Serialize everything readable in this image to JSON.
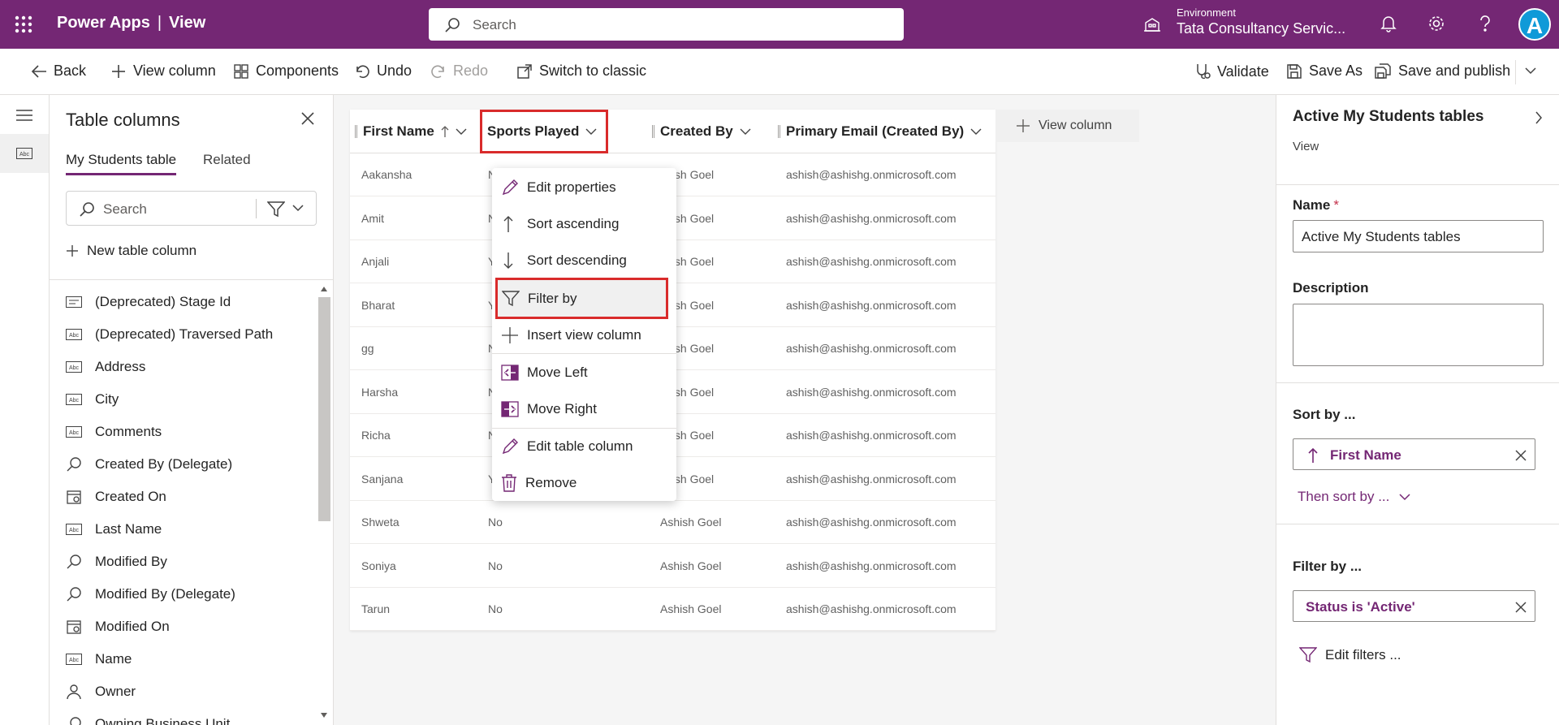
{
  "appbar": {
    "app_name": "Power Apps",
    "separator": "|",
    "section": "View",
    "search_placeholder": "Search",
    "environment_label": "Environment",
    "environment_value": "Tata Consultancy Servic...",
    "avatar_letter": "A"
  },
  "cmdbar": {
    "back": "Back",
    "view_column": "View column",
    "components": "Components",
    "undo": "Undo",
    "redo": "Redo",
    "switch_classic": "Switch to classic",
    "validate": "Validate",
    "save_as": "Save As",
    "save_publish": "Save and publish"
  },
  "table_columns": {
    "title": "Table columns",
    "tabs": [
      "My Students table",
      "Related"
    ],
    "search_placeholder": "Search",
    "new_column": "New table column",
    "items": [
      {
        "label": "(Deprecated) Stage Id",
        "icon": "id"
      },
      {
        "label": "(Deprecated) Traversed Path",
        "icon": "text"
      },
      {
        "label": "Address",
        "icon": "text"
      },
      {
        "label": "City",
        "icon": "text"
      },
      {
        "label": "Comments",
        "icon": "text"
      },
      {
        "label": "Created By (Delegate)",
        "icon": "lookup"
      },
      {
        "label": "Created On",
        "icon": "date"
      },
      {
        "label": "Last Name",
        "icon": "text"
      },
      {
        "label": "Modified By",
        "icon": "lookup"
      },
      {
        "label": "Modified By (Delegate)",
        "icon": "lookup"
      },
      {
        "label": "Modified On",
        "icon": "date"
      },
      {
        "label": "Name",
        "icon": "text"
      },
      {
        "label": "Owner",
        "icon": "person"
      },
      {
        "label": "Owning Business Unit",
        "icon": "lookup"
      }
    ]
  },
  "grid": {
    "columns": [
      "First Name",
      "Sports Played",
      "Created By",
      "Primary Email (Created By)"
    ],
    "add_view_column": "View column",
    "rows": [
      {
        "first": "Aakansha",
        "sports": "N",
        "created": "shish Goel",
        "email": "ashish@ashishg.onmicrosoft.com"
      },
      {
        "first": "Amit",
        "sports": "N",
        "created": "shish Goel",
        "email": "ashish@ashishg.onmicrosoft.com"
      },
      {
        "first": "Anjali",
        "sports": "Y",
        "created": "shish Goel",
        "email": "ashish@ashishg.onmicrosoft.com"
      },
      {
        "first": "Bharat",
        "sports": "Y",
        "created": "shish Goel",
        "email": "ashish@ashishg.onmicrosoft.com"
      },
      {
        "first": "gg",
        "sports": "N",
        "created": "shish Goel",
        "email": "ashish@ashishg.onmicrosoft.com"
      },
      {
        "first": "Harsha",
        "sports": "N",
        "created": "shish Goel",
        "email": "ashish@ashishg.onmicrosoft.com"
      },
      {
        "first": "Richa",
        "sports": "N",
        "created": "shish Goel",
        "email": "ashish@ashishg.onmicrosoft.com"
      },
      {
        "first": "Sanjana",
        "sports": "Y",
        "created": "shish Goel",
        "email": "ashish@ashishg.onmicrosoft.com"
      },
      {
        "first": "Shweta",
        "sports": "No",
        "created": "Ashish Goel",
        "email": "ashish@ashishg.onmicrosoft.com"
      },
      {
        "first": "Soniya",
        "sports": "No",
        "created": "Ashish Goel",
        "email": "ashish@ashishg.onmicrosoft.com"
      },
      {
        "first": "Tarun",
        "sports": "No",
        "created": "Ashish Goel",
        "email": "ashish@ashishg.onmicrosoft.com"
      }
    ]
  },
  "context_menu": {
    "items": [
      "Edit properties",
      "Sort ascending",
      "Sort descending",
      "Filter by",
      "Insert view column",
      "Move Left",
      "Move Right",
      "Edit table column",
      "Remove"
    ],
    "highlighted": "Filter by"
  },
  "right_panel": {
    "title": "Active My Students tables",
    "subtitle": "View",
    "name_label": "Name",
    "required_mark": "*",
    "name_value": "Active My Students tables",
    "description_label": "Description",
    "sort_label": "Sort by ...",
    "sort_value": "First Name",
    "then_sort": "Then sort by ...",
    "filter_label": "Filter by ...",
    "filter_value": "Status is 'Active'",
    "edit_filters": "Edit filters ..."
  },
  "colors": {
    "brand": "#742774",
    "highlight": "#d92b2b",
    "avatar": "#0f9ad8"
  }
}
